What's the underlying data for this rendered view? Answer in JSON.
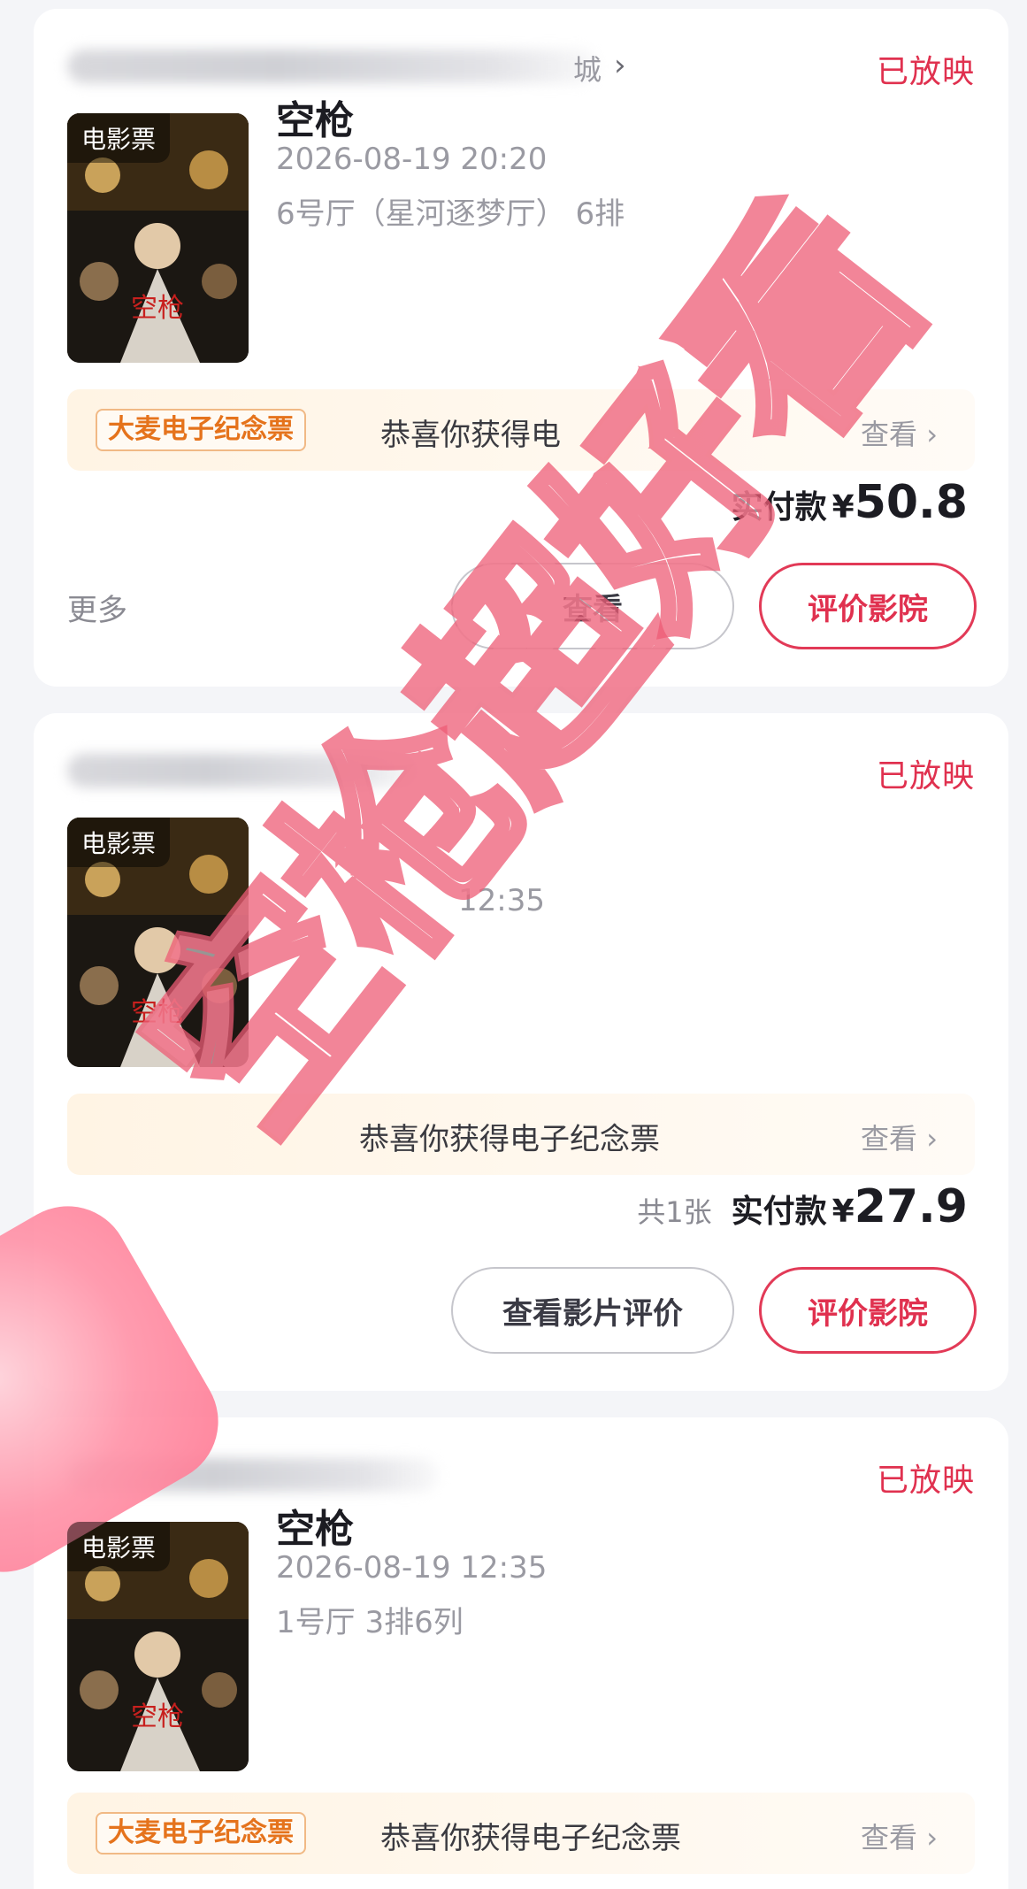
{
  "orders": [
    {
      "cinema_suffix": "城",
      "status": "已放映",
      "poster_tag": "电影票",
      "movie_title": "空枪",
      "datetime": "2026-08-19 20:20",
      "seat_info": "6号厅（星河逐梦厅） 6排",
      "souvenir_badge": "大麦电子纪念票",
      "souvenir_text": "恭喜你获得电",
      "souvenir_view": "查看",
      "quantity": "",
      "pay_label": "实付款",
      "currency": "¥",
      "amount": "50.8",
      "more": "更多",
      "review_movie": "查看",
      "review_cinema": "评价影院"
    },
    {
      "cinema_suffix": "",
      "status": "已放映",
      "poster_tag": "电影票",
      "movie_title": "",
      "datetime": "12:35",
      "seat_info": "",
      "souvenir_badge": "",
      "souvenir_text": "恭喜你获得电子纪念票",
      "souvenir_view": "查看",
      "quantity": "共1张",
      "pay_label": "实付款",
      "currency": "¥",
      "amount": "27.9",
      "more": "",
      "review_movie": "查看影片评价",
      "review_cinema": "评价影院"
    },
    {
      "cinema_suffix": "",
      "status": "已放映",
      "poster_tag": "电影票",
      "movie_title": "空枪",
      "datetime": "2026-08-19 12:35",
      "seat_info": "1号厅 3排6列",
      "souvenir_badge": "大麦电子纪念票",
      "souvenir_text": "恭喜你获得电子纪念票",
      "souvenir_view": "查看"
    }
  ],
  "watermark": "空枪超好看",
  "icons": {
    "chevron": "chevron-right-icon"
  },
  "colors": {
    "accent": "#e0314f",
    "souvenir_orange": "#e5731c",
    "background": "#f4f5f8"
  }
}
